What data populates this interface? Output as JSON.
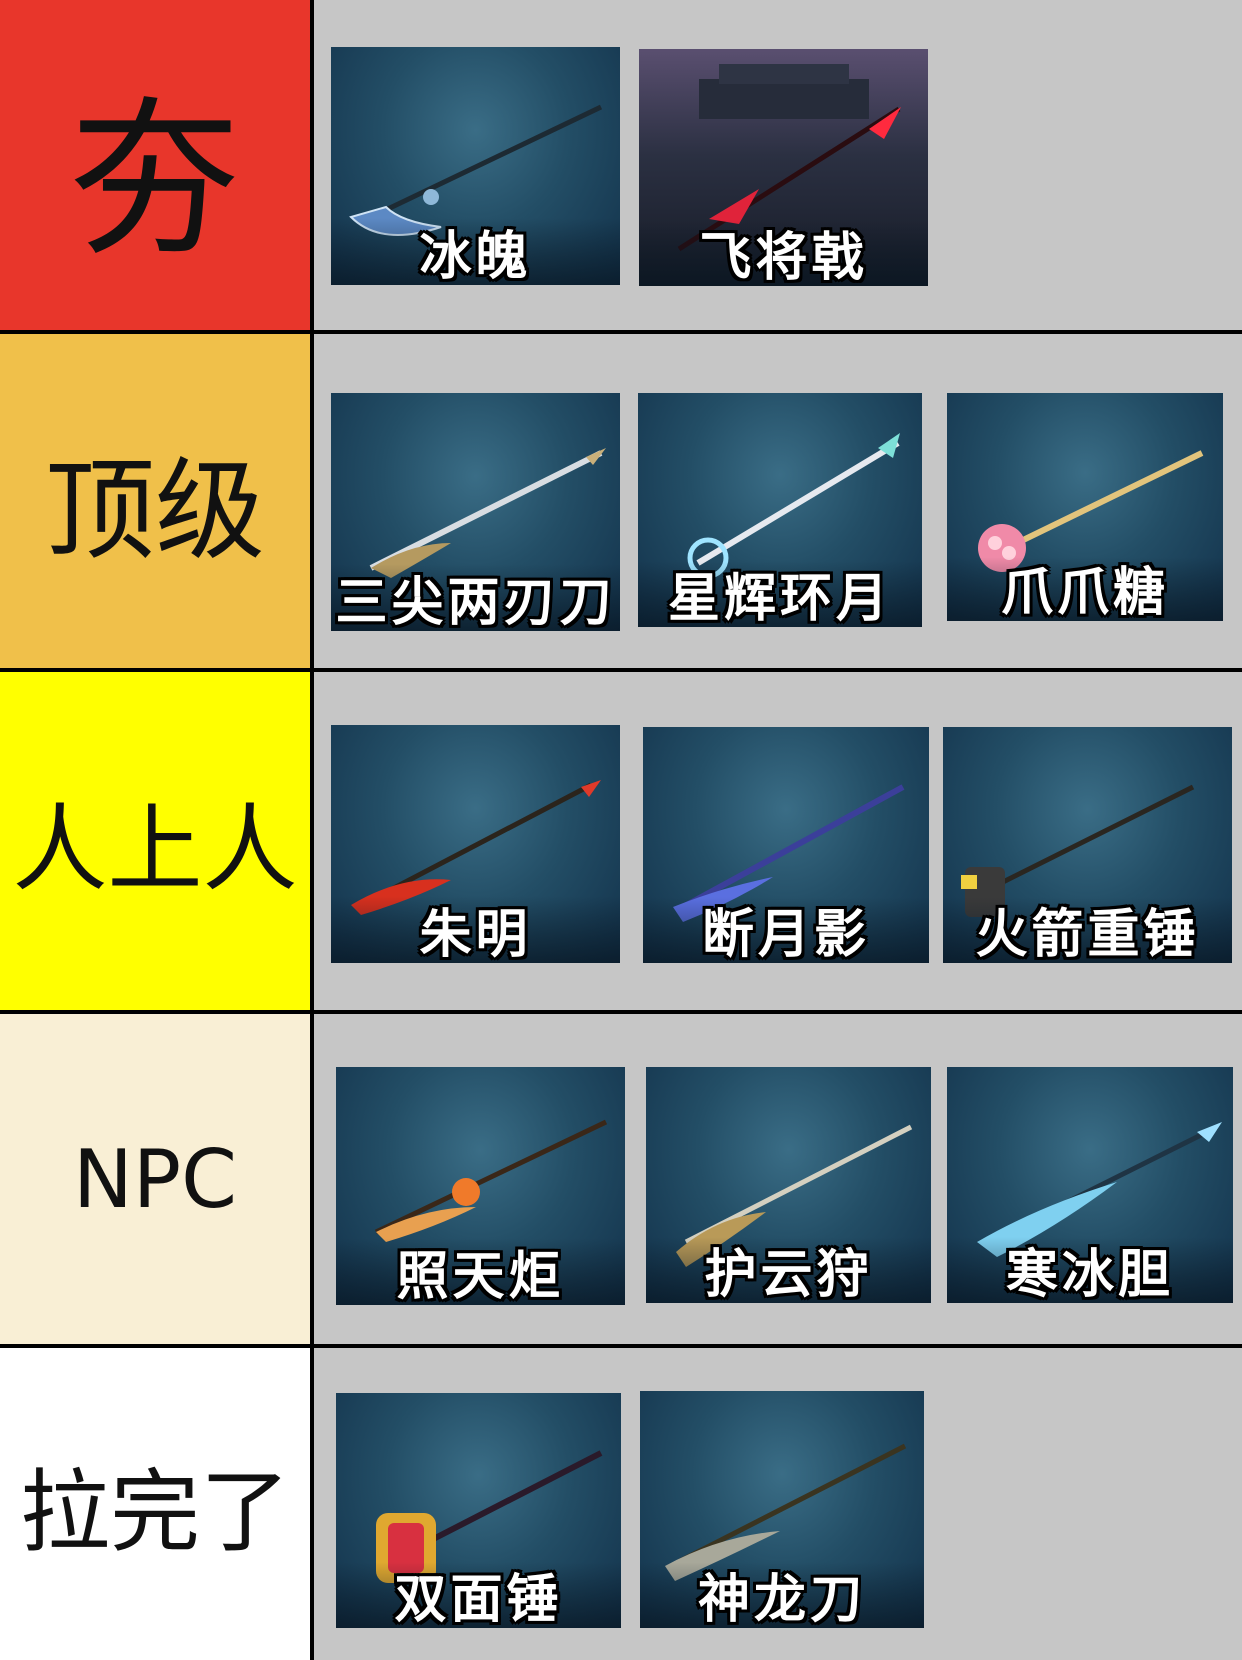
{
  "tiers": [
    {
      "label": "夯",
      "color": "#e8362b",
      "items": [
        "冰魄",
        "飞将戟"
      ]
    },
    {
      "label": "顶级",
      "color": "#f0c04a",
      "items": [
        "三尖两刃刀",
        "星辉环月",
        "爪爪糖"
      ]
    },
    {
      "label": "人上人",
      "color": "#ffff00",
      "items": [
        "朱明",
        "断月影",
        "火箭重锤"
      ]
    },
    {
      "label": "NPC",
      "color": "#f9efd5",
      "items": [
        "照天炬",
        "护云狩",
        "寒冰胆"
      ]
    },
    {
      "label": "拉完了",
      "color": "#ffffff",
      "items": [
        "双面锤",
        "神龙刀"
      ]
    }
  ]
}
